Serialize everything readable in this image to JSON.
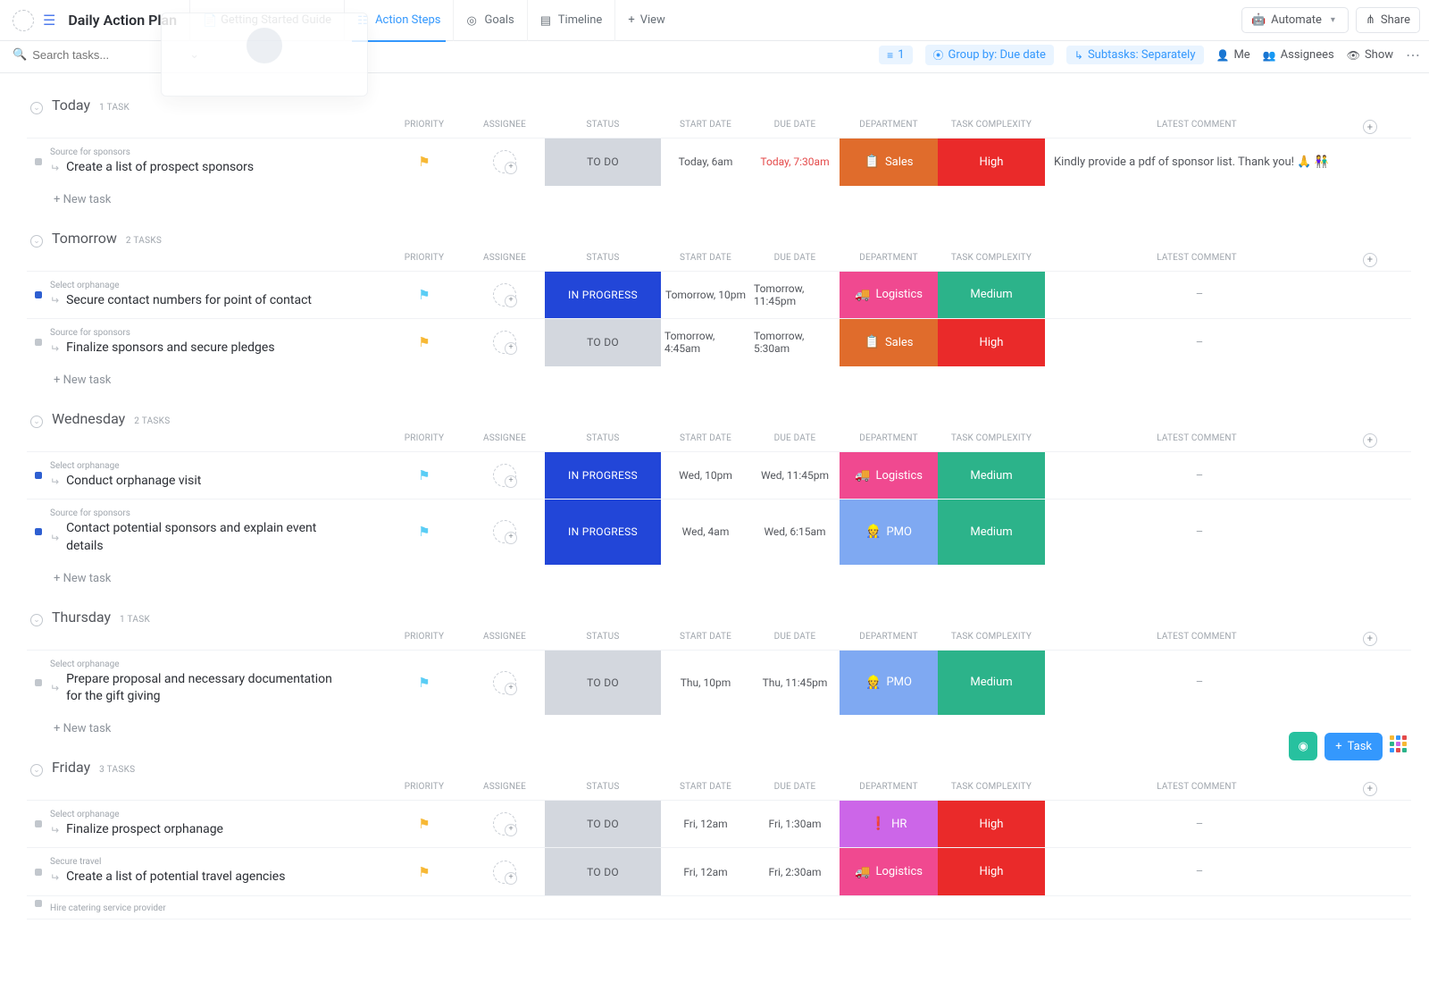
{
  "header": {
    "title": "Daily Action Plan",
    "tabs": [
      {
        "label": "Getting Started Guide",
        "icon": "doc",
        "active": false
      },
      {
        "label": "Action Steps",
        "icon": "list",
        "active": true
      },
      {
        "label": "Goals",
        "icon": "target",
        "active": false
      },
      {
        "label": "Timeline",
        "icon": "gantt",
        "active": false
      }
    ],
    "add_view": "View",
    "automate": "Automate",
    "share": "Share"
  },
  "toolbar": {
    "search_placeholder": "Search tasks...",
    "filter_count": "1",
    "group_by": "Group by: Due date",
    "subtasks": "Subtasks: Separately",
    "me": "Me",
    "assignees": "Assignees",
    "show": "Show"
  },
  "columns": [
    "",
    "PRIORITY",
    "ASSIGNEE",
    "STATUS",
    "START DATE",
    "DUE DATE",
    "DEPARTMENT",
    "TASK COMPLEXITY",
    "LATEST COMMENT",
    ""
  ],
  "new_task_label": "+ New task",
  "float": {
    "task_btn": "Task"
  },
  "groups": [
    {
      "name": "Today",
      "count": "1 TASK",
      "tasks": [
        {
          "parent": "Source for sponsors",
          "title": "Create a list of prospect sponsors",
          "square": "grey",
          "priority": "yellow",
          "status": {
            "label": "TO DO",
            "style": "todo"
          },
          "start": "Today, 6am",
          "due": "Today, 7:30am",
          "due_red": true,
          "dept": {
            "label": "Sales",
            "emoji": "📋",
            "style": "sales"
          },
          "complexity": {
            "label": "High",
            "style": "high"
          },
          "comment": "Kindly provide a pdf of sponsor list. Thank you! 🙏 👫"
        }
      ]
    },
    {
      "name": "Tomorrow",
      "count": "2 TASKS",
      "tasks": [
        {
          "parent": "Select orphanage",
          "title": "Secure contact numbers for point of contact",
          "square": "blue",
          "priority": "cyan",
          "status": {
            "label": "IN PROGRESS",
            "style": "progress"
          },
          "start": "Tomorrow, 10pm",
          "due": "Tomorrow, 11:45pm",
          "dept": {
            "label": "Logistics",
            "emoji": "🚚",
            "style": "logistics"
          },
          "complexity": {
            "label": "Medium",
            "style": "medium"
          },
          "comment": "–"
        },
        {
          "parent": "Source for sponsors",
          "title": "Finalize sponsors and secure pledges",
          "square": "grey",
          "priority": "yellow",
          "status": {
            "label": "TO DO",
            "style": "todo"
          },
          "start": "Tomorrow, 4:45am",
          "due": "Tomorrow, 5:30am",
          "dept": {
            "label": "Sales",
            "emoji": "📋",
            "style": "sales"
          },
          "complexity": {
            "label": "High",
            "style": "high"
          },
          "comment": "–"
        }
      ]
    },
    {
      "name": "Wednesday",
      "count": "2 TASKS",
      "tasks": [
        {
          "parent": "Select orphanage",
          "title": "Conduct orphanage visit",
          "square": "blue",
          "priority": "cyan",
          "status": {
            "label": "IN PROGRESS",
            "style": "progress"
          },
          "start": "Wed, 10pm",
          "due": "Wed, 11:45pm",
          "dept": {
            "label": "Logistics",
            "emoji": "🚚",
            "style": "logistics"
          },
          "complexity": {
            "label": "Medium",
            "style": "medium"
          },
          "comment": "–"
        },
        {
          "parent": "Source for sponsors",
          "title": "Contact potential sponsors and explain event details",
          "square": "blue",
          "priority": "cyan",
          "status": {
            "label": "IN PROGRESS",
            "style": "progress"
          },
          "start": "Wed, 4am",
          "due": "Wed, 6:15am",
          "dept": {
            "label": "PMO",
            "emoji": "👷",
            "style": "pmo"
          },
          "complexity": {
            "label": "Medium",
            "style": "medium"
          },
          "comment": "–"
        }
      ]
    },
    {
      "name": "Thursday",
      "count": "1 TASK",
      "tasks": [
        {
          "parent": "Select orphanage",
          "title": "Prepare proposal and necessary documentation for the gift giving",
          "square": "grey",
          "priority": "cyan",
          "status": {
            "label": "TO DO",
            "style": "todo"
          },
          "start": "Thu, 10pm",
          "due": "Thu, 11:45pm",
          "dept": {
            "label": "PMO",
            "emoji": "👷",
            "style": "pmo"
          },
          "complexity": {
            "label": "Medium",
            "style": "medium"
          },
          "comment": "–"
        }
      ]
    },
    {
      "name": "Friday",
      "count": "3 TASKS",
      "tasks": [
        {
          "parent": "Select orphanage",
          "title": "Finalize prospect orphanage",
          "square": "grey",
          "priority": "yellow",
          "status": {
            "label": "TO DO",
            "style": "todo"
          },
          "start": "Fri, 12am",
          "due": "Fri, 1:30am",
          "dept": {
            "label": "HR",
            "emoji": "❗",
            "style": "hr"
          },
          "complexity": {
            "label": "High",
            "style": "high"
          },
          "comment": "–"
        },
        {
          "parent": "Secure travel",
          "title": "Create a list of potential travel agencies",
          "square": "grey",
          "priority": "yellow",
          "status": {
            "label": "TO DO",
            "style": "todo"
          },
          "start": "Fri, 12am",
          "due": "Fri, 2:30am",
          "dept": {
            "label": "Logistics",
            "emoji": "🚚",
            "style": "logistics"
          },
          "complexity": {
            "label": "High",
            "style": "high"
          },
          "comment": "–"
        },
        {
          "parent": "Hire catering service provider",
          "title": "",
          "square": "grey",
          "partial": true
        }
      ]
    }
  ]
}
